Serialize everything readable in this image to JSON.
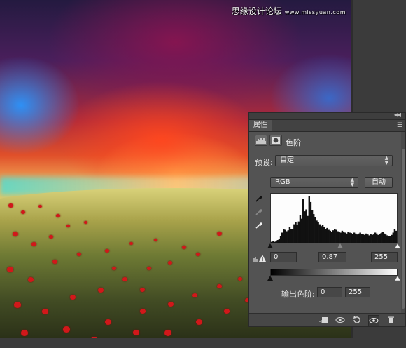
{
  "watermark": {
    "text": "思缘设计论坛",
    "url": "www.missyuan.com"
  },
  "panel": {
    "tab_label": "属性",
    "adjustment_title": "色阶",
    "preset_label": "预设:",
    "preset_value": "自定",
    "channel_value": "RGB",
    "auto_button": "自动",
    "input_black": "0",
    "input_gamma": "0.87",
    "input_white": "255",
    "output_label": "输出色阶:",
    "output_black": "0",
    "output_white": "255"
  },
  "histogram": {
    "bins": [
      2,
      3,
      2,
      4,
      6,
      9,
      15,
      22,
      30,
      28,
      25,
      27,
      34,
      30,
      29,
      40,
      45,
      38,
      46,
      60,
      52,
      95,
      68,
      72,
      58,
      100,
      88,
      70,
      62,
      55,
      48,
      44,
      40,
      36,
      38,
      34,
      30,
      32,
      28,
      26,
      24,
      27,
      30,
      28,
      25,
      24,
      22,
      26,
      23,
      22,
      20,
      24,
      22,
      21,
      19,
      22,
      20,
      18,
      20,
      22,
      19,
      18,
      17,
      20,
      18,
      16,
      19,
      17,
      18,
      22,
      20,
      17,
      19,
      21,
      24,
      20,
      18,
      16,
      15,
      14,
      17,
      22,
      30,
      26
    ]
  },
  "colors": {
    "panel_bg": "#535353",
    "accent_red": "#d1181a"
  },
  "icons": [
    "histogram-icon",
    "mask-icon",
    "eyedropper-icon",
    "warning-icon",
    "menu-icon",
    "clip-to-layer-icon",
    "view-previous-icon",
    "reset-icon",
    "visibility-eye-icon",
    "trash-icon"
  ]
}
